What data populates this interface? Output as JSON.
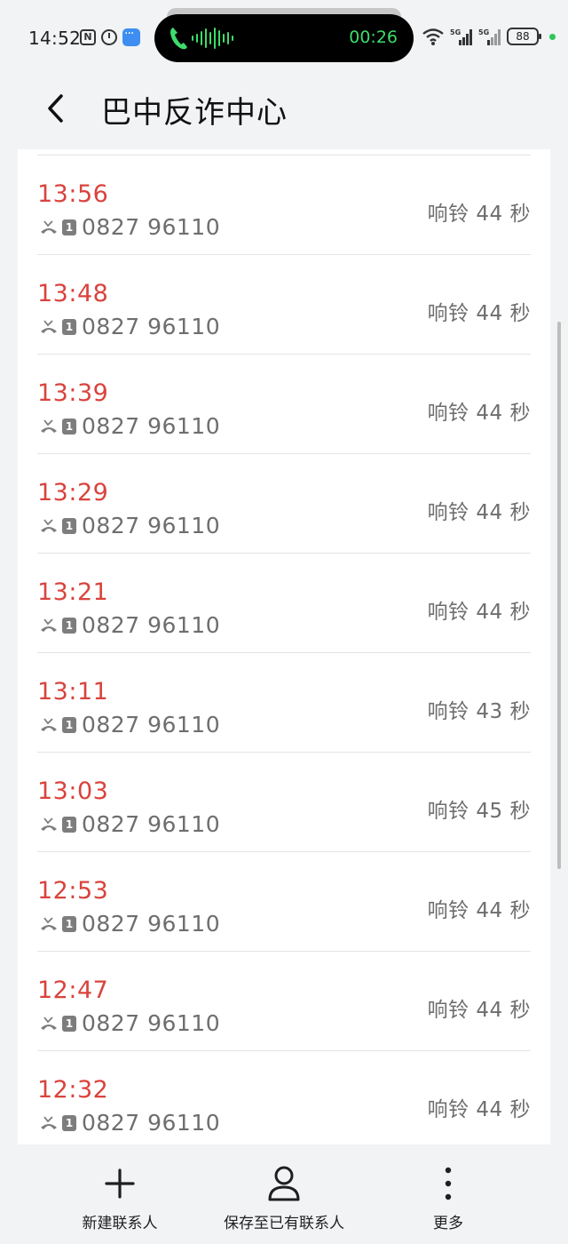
{
  "status_bar": {
    "time": "14:52",
    "call_timer": "00:26",
    "battery": "88"
  },
  "header": {
    "title": "巴中反诈中心"
  },
  "calls": [
    {
      "time": "13:56",
      "number": "0827 96110",
      "duration": "响铃 44 秒",
      "sim": "1"
    },
    {
      "time": "13:48",
      "number": "0827 96110",
      "duration": "响铃 44 秒",
      "sim": "1"
    },
    {
      "time": "13:39",
      "number": "0827 96110",
      "duration": "响铃 44 秒",
      "sim": "1"
    },
    {
      "time": "13:29",
      "number": "0827 96110",
      "duration": "响铃 44 秒",
      "sim": "1"
    },
    {
      "time": "13:21",
      "number": "0827 96110",
      "duration": "响铃 44 秒",
      "sim": "1"
    },
    {
      "time": "13:11",
      "number": "0827 96110",
      "duration": "响铃 43 秒",
      "sim": "1"
    },
    {
      "time": "13:03",
      "number": "0827 96110",
      "duration": "响铃 45 秒",
      "sim": "1"
    },
    {
      "time": "12:53",
      "number": "0827 96110",
      "duration": "响铃 44 秒",
      "sim": "1"
    },
    {
      "time": "12:47",
      "number": "0827 96110",
      "duration": "响铃 44 秒",
      "sim": "1"
    },
    {
      "time": "12:32",
      "number": "0827 96110",
      "duration": "响铃 44 秒",
      "sim": "1"
    }
  ],
  "toolbar": {
    "new_contact": "新建联系人",
    "save_existing": "保存至已有联系人",
    "more": "更多"
  },
  "colors": {
    "missed_time": "#d9433d",
    "call_green": "#3ddc6a",
    "secondary_text": "#6e6e6e",
    "page_background": "#f1f3f5"
  },
  "icons": {
    "status_left": [
      "nfc-icon",
      "alarm-icon",
      "message-icon"
    ],
    "status_right": [
      "wifi-icon",
      "signal-5g-icon",
      "signal-5g-icon",
      "battery-icon"
    ],
    "row": [
      "missed-call-icon",
      "sim-icon"
    ],
    "toolbar": [
      "plus-icon",
      "person-icon",
      "more-vertical-icon"
    ]
  }
}
